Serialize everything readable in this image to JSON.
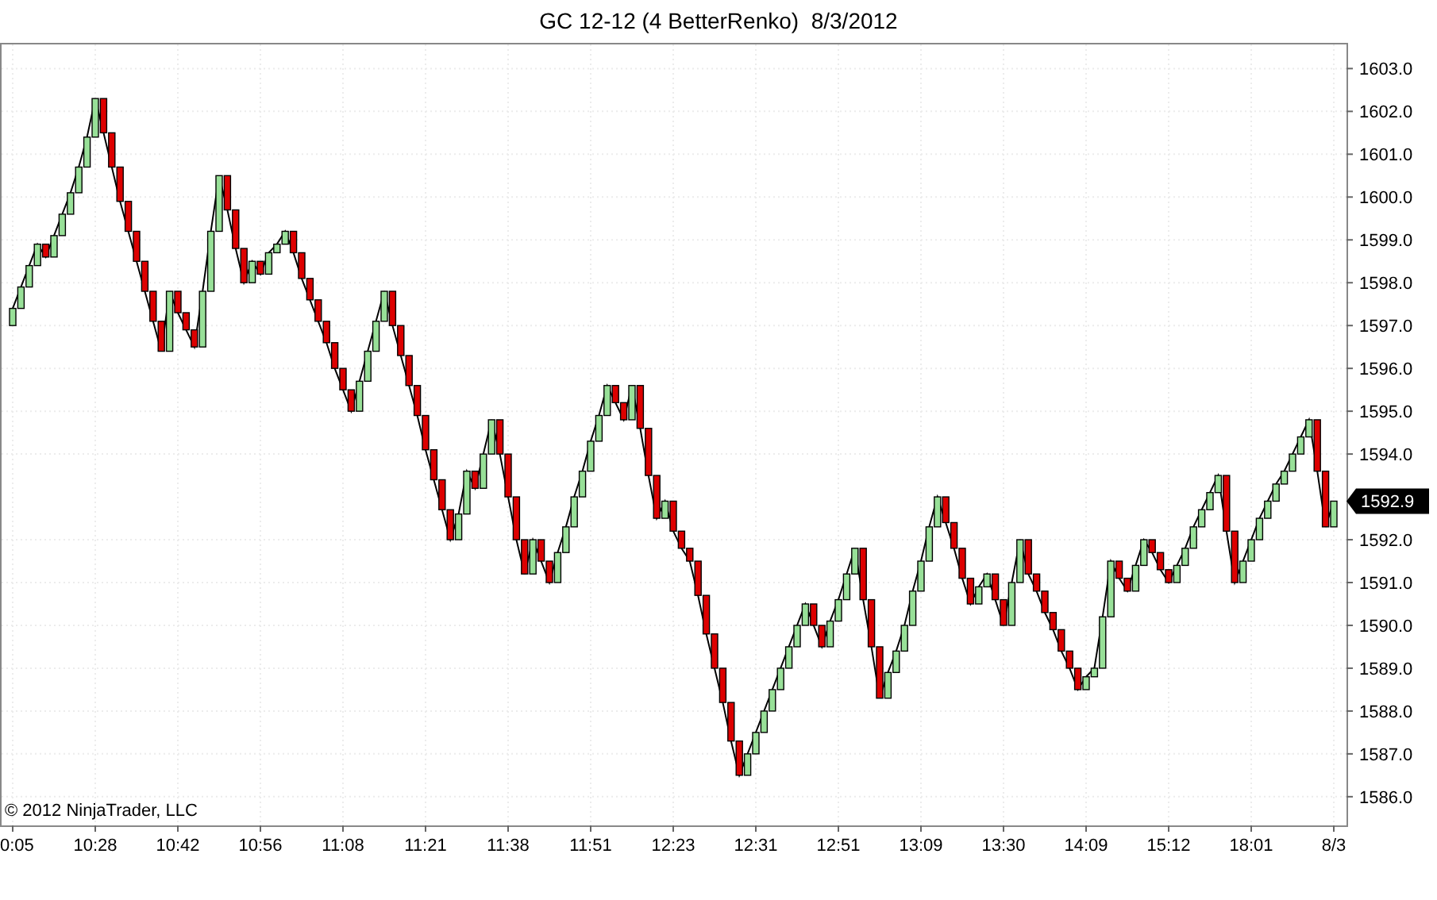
{
  "chart_data": {
    "type": "line",
    "title": "GC 12-12 (4 BetterRenko)  8/3/2012",
    "categories": [
      "0:05",
      null,
      null,
      null,
      null,
      null,
      null,
      null,
      null,
      null,
      "10:28",
      null,
      null,
      null,
      null,
      null,
      null,
      null,
      null,
      null,
      "10:42",
      null,
      null,
      null,
      null,
      null,
      null,
      null,
      null,
      null,
      "10:56",
      null,
      null,
      null,
      null,
      null,
      null,
      null,
      null,
      null,
      "11:08",
      null,
      null,
      null,
      null,
      null,
      null,
      null,
      null,
      null,
      "11:21",
      null,
      null,
      null,
      null,
      null,
      null,
      null,
      null,
      null,
      "11:38",
      null,
      null,
      null,
      null,
      null,
      null,
      null,
      null,
      null,
      "11:51",
      null,
      null,
      null,
      null,
      null,
      null,
      null,
      null,
      null,
      "12:23",
      null,
      null,
      null,
      null,
      null,
      null,
      null,
      null,
      null,
      "12:31",
      null,
      null,
      null,
      null,
      null,
      null,
      null,
      null,
      null,
      "12:51",
      null,
      null,
      null,
      null,
      null,
      null,
      null,
      null,
      null,
      "13:09",
      null,
      null,
      null,
      null,
      null,
      null,
      null,
      null,
      null,
      "13:30",
      null,
      null,
      null,
      null,
      null,
      null,
      null,
      null,
      null,
      "14:09",
      null,
      null,
      null,
      null,
      null,
      null,
      null,
      null,
      null,
      "15:12",
      null,
      null,
      null,
      null,
      null,
      null,
      null,
      null,
      null,
      "18:01",
      null,
      null,
      null,
      null,
      null,
      null,
      null,
      null,
      null,
      "8/3"
    ],
    "series": [
      {
        "color": "#000000",
        "values": [
          1597.4,
          1597.9,
          1598.4,
          1598.9,
          1598.6,
          1599.1,
          1599.6,
          1600.1,
          1600.7,
          1601.4,
          1602.3,
          1601.5,
          1600.7,
          1599.9,
          1599.2,
          1598.5,
          1597.8,
          1597.1,
          1596.4,
          1597.8,
          1597.3,
          1596.9,
          1596.5,
          1597.8,
          1599.2,
          1600.5,
          1599.7,
          1598.8,
          1598.0,
          1598.5,
          1598.2,
          1598.7,
          1598.9,
          1599.2,
          1598.7,
          1598.1,
          1597.6,
          1597.1,
          1596.6,
          1596.0,
          1595.5,
          1595.0,
          1595.7,
          1596.4,
          1597.1,
          1597.8,
          1597.0,
          1596.3,
          1595.6,
          1594.9,
          1594.1,
          1593.4,
          1592.7,
          1592.0,
          1592.6,
          1593.6,
          1593.2,
          1594.0,
          1594.8,
          1594.0,
          1593.0,
          1592.0,
          1591.2,
          1592.0,
          1591.5,
          1591.0,
          1591.7,
          1592.3,
          1593.0,
          1593.6,
          1594.3,
          1594.9,
          1595.6,
          1595.2,
          1594.8,
          1595.6,
          1594.6,
          1593.5,
          1592.5,
          1592.9,
          1592.2,
          1591.8,
          1591.5,
          1590.7,
          1589.8,
          1589.0,
          1588.2,
          1587.3,
          1586.5,
          1587.0,
          1587.5,
          1588.0,
          1588.5,
          1589.0,
          1589.5,
          1590.0,
          1590.5,
          1590.0,
          1589.5,
          1590.1,
          1590.6,
          1591.2,
          1591.8,
          1590.6,
          1589.5,
          1588.3,
          1588.9,
          1589.4,
          1590.0,
          1590.8,
          1591.5,
          1592.3,
          1593.0,
          1592.4,
          1591.8,
          1591.1,
          1590.5,
          1590.9,
          1591.2,
          1590.6,
          1590.0,
          1591.0,
          1592.0,
          1591.2,
          1590.8,
          1590.3,
          1589.9,
          1589.4,
          1589.0,
          1588.5,
          1588.8,
          1589.0,
          1590.2,
          1591.5,
          1591.1,
          1590.8,
          1591.4,
          1592.0,
          1591.7,
          1591.3,
          1591.0,
          1591.4,
          1591.8,
          1592.3,
          1592.7,
          1593.1,
          1593.5,
          1592.2,
          1591.0,
          1591.5,
          1592.0,
          1592.5,
          1592.9,
          1593.3,
          1593.6,
          1594.0,
          1594.4,
          1594.8,
          1593.6,
          1592.3,
          1592.9
        ]
      }
    ],
    "ylim": [
      1585.33,
      1603.6
    ],
    "grid": true,
    "yticks": [
      {
        "value": 1586,
        "label": "1586.0"
      },
      {
        "value": 1587,
        "label": "1587.0"
      },
      {
        "value": 1588,
        "label": "1588.0"
      },
      {
        "value": 1589,
        "label": "1589.0"
      },
      {
        "value": 1590,
        "label": "1590.0"
      },
      {
        "value": 1591,
        "label": "1591.0"
      },
      {
        "value": 1592,
        "label": "1592.0"
      },
      {
        "value": 1594,
        "label": "1594.0"
      },
      {
        "value": 1595,
        "label": "1595.0"
      },
      {
        "value": 1596,
        "label": "1596.0"
      },
      {
        "value": 1597,
        "label": "1597.0"
      },
      {
        "value": 1598,
        "label": "1598.0"
      },
      {
        "value": 1599,
        "label": "1599.0"
      },
      {
        "value": 1600,
        "label": "1600.0"
      },
      {
        "value": 1601,
        "label": "1601.0"
      },
      {
        "value": 1602,
        "label": "1602.0"
      },
      {
        "value": 1603,
        "label": "1603.0"
      }
    ]
  },
  "last_price": "1592.9",
  "copyright": "© 2012 NinjaTrader, LLC"
}
